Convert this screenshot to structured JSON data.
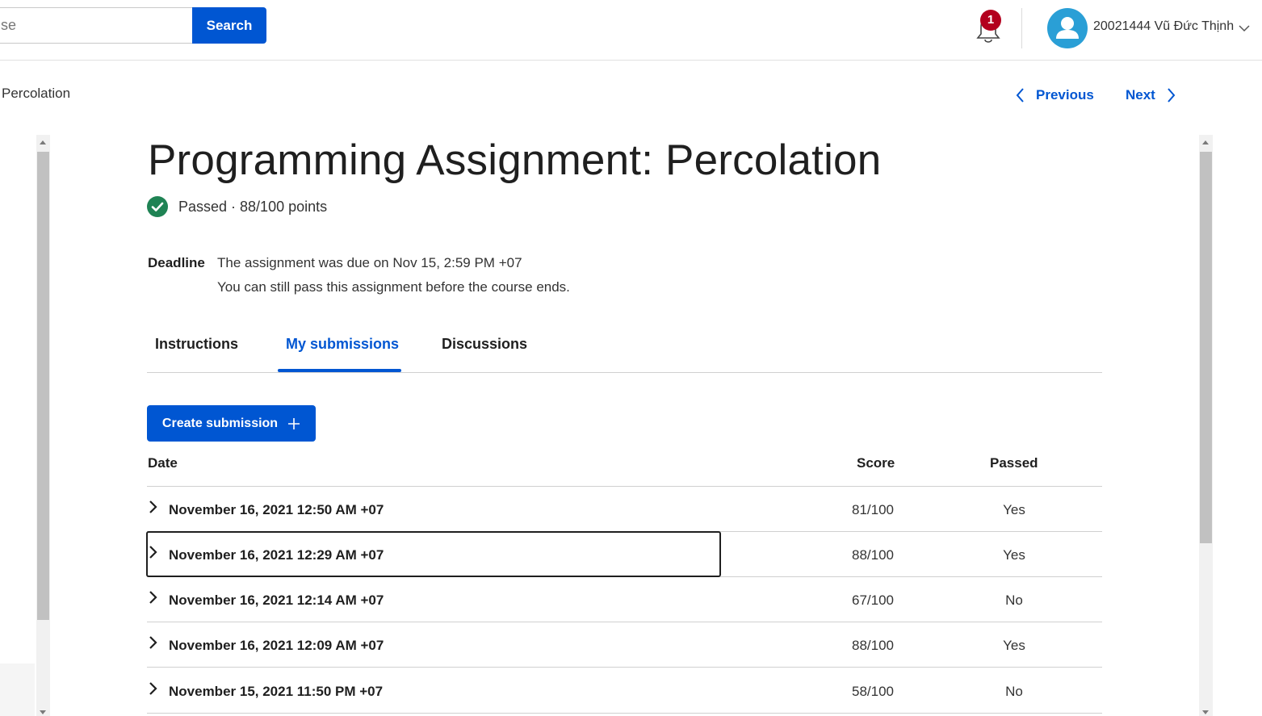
{
  "header": {
    "search_placeholder": "se",
    "search_button": "Search",
    "notification_count": "1",
    "user_name": "20021444 Vũ Đức Thịnh"
  },
  "nav": {
    "breadcrumb": "Percolation",
    "previous": "Previous",
    "next": "Next"
  },
  "assignment": {
    "title": "Programming Assignment: Percolation",
    "status": "Passed · 88/100 points",
    "deadline_label": "Deadline",
    "deadline_text": "The assignment was due on Nov 15, 2:59 PM +07",
    "deadline_note": "You can still pass this assignment before the course ends."
  },
  "tabs": [
    {
      "label": "Instructions"
    },
    {
      "label": "My submissions"
    },
    {
      "label": "Discussions"
    }
  ],
  "create_button": "Create submission",
  "table": {
    "headers": {
      "date": "Date",
      "score": "Score",
      "passed": "Passed"
    },
    "rows": [
      {
        "date": "November 16, 2021 12:50 AM +07",
        "score": "81/100",
        "passed": "Yes"
      },
      {
        "date": "November 16, 2021 12:29 AM +07",
        "score": "88/100",
        "passed": "Yes"
      },
      {
        "date": "November 16, 2021 12:14 AM +07",
        "score": "67/100",
        "passed": "No"
      },
      {
        "date": "November 16, 2021 12:09 AM +07",
        "score": "88/100",
        "passed": "Yes"
      },
      {
        "date": "November 15, 2021 11:50 PM +07",
        "score": "58/100",
        "passed": "No"
      }
    ]
  },
  "colors": {
    "accent": "#0056d2",
    "success": "#1f8354",
    "badge": "#b3001e",
    "avatar": "#2a9fd6"
  },
  "icons": [
    "bell-icon",
    "user-avatar-icon",
    "chevron-down-icon",
    "chevron-left-icon",
    "chevron-right-icon",
    "check-circle-icon",
    "plus-icon"
  ]
}
